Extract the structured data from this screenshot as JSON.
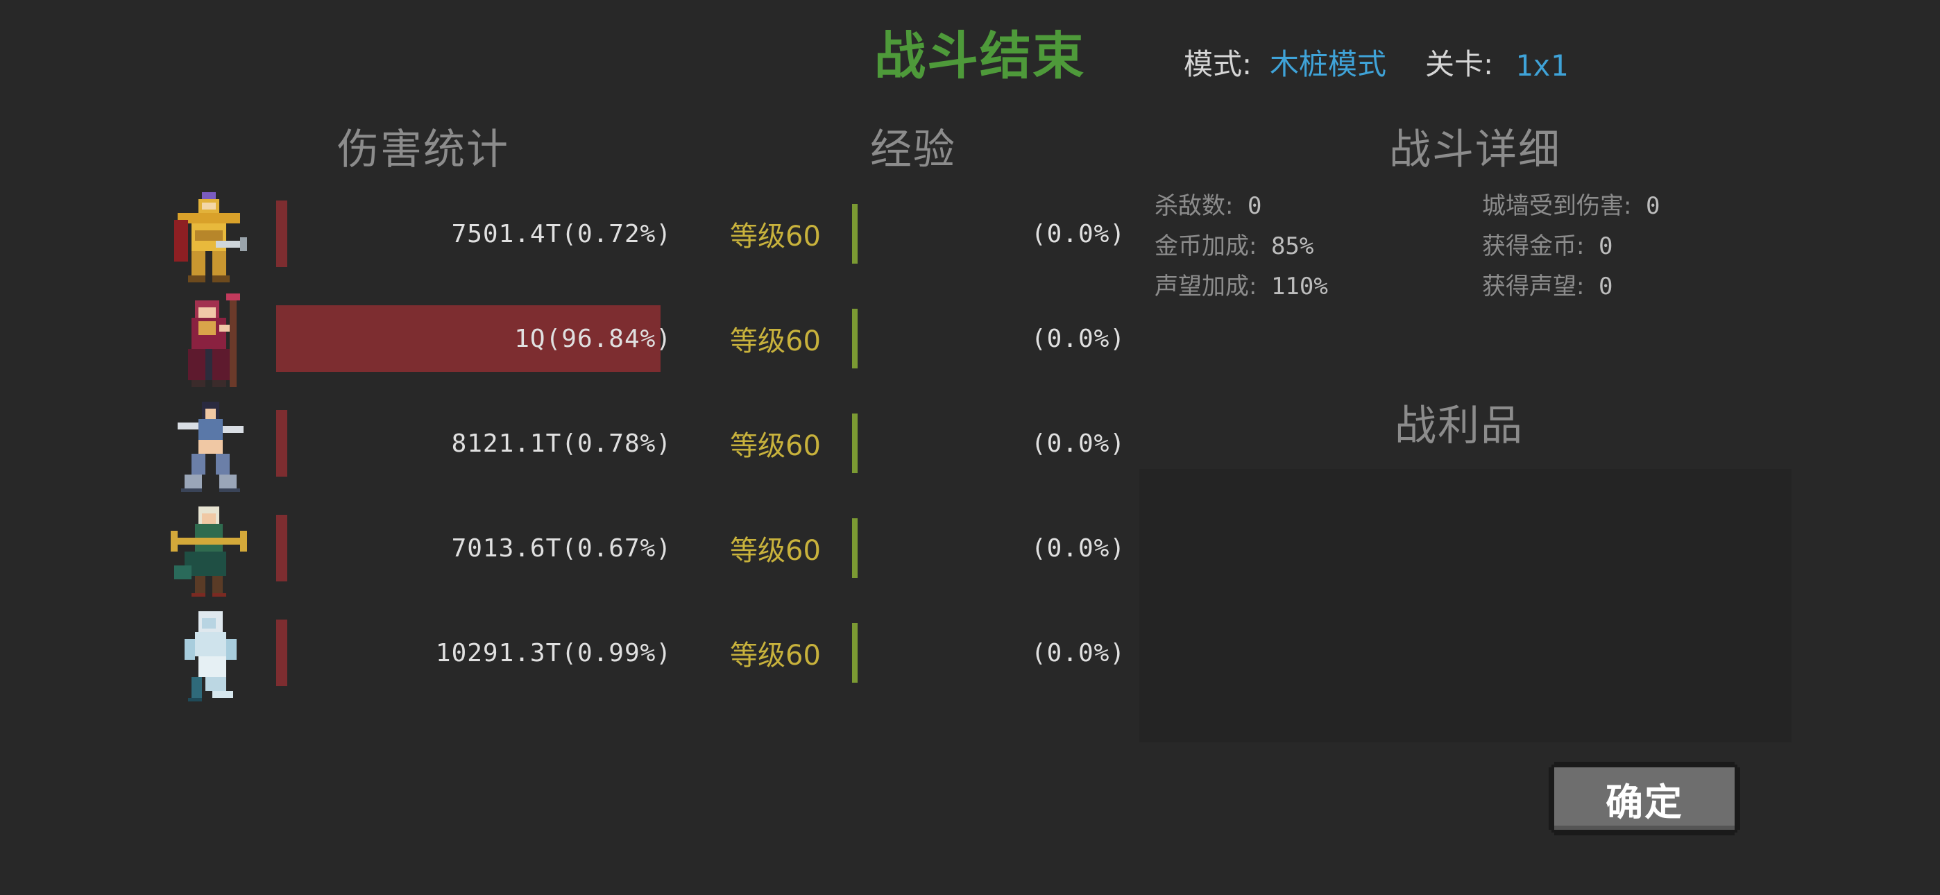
{
  "header": {
    "title": "战斗结束",
    "mode_label": "模式:",
    "mode_value": "木桩模式",
    "stage_label": "关卡:",
    "stage_value": "1x1"
  },
  "sections": {
    "damage": "伤害统计",
    "exp": "经验",
    "details": "战斗详细",
    "loot": "战利品"
  },
  "heroes": [
    {
      "icon": "golden-knight-icon",
      "damage": "7501.4T(0.72%)",
      "damage_share": 0.0072,
      "level": "等级60",
      "exp": "(0.0%)",
      "exp_share": 0.0
    },
    {
      "icon": "crimson-mage-icon",
      "damage": "1Q(96.84%)",
      "damage_share": 0.9684,
      "level": "等级60",
      "exp": "(0.0%)",
      "exp_share": 0.0
    },
    {
      "icon": "blade-dancer-icon",
      "damage": "8121.1T(0.78%)",
      "damage_share": 0.0078,
      "level": "等级60",
      "exp": "(0.0%)",
      "exp_share": 0.0
    },
    {
      "icon": "elf-archer-icon",
      "damage": "7013.6T(0.67%)",
      "damage_share": 0.0067,
      "level": "等级60",
      "exp": "(0.0%)",
      "exp_share": 0.0
    },
    {
      "icon": "ice-spirit-icon",
      "damage": "10291.3T(0.99%)",
      "damage_share": 0.0099,
      "level": "等级60",
      "exp": "(0.0%)",
      "exp_share": 0.0
    }
  ],
  "details": {
    "kills_label": "杀敌数:",
    "kills_value": "0",
    "gold_bonus_label": "金币加成:",
    "gold_bonus_value": "85%",
    "fame_bonus_label": "声望加成:",
    "fame_bonus_value": "110%",
    "wall_damage_label": "城墙受到伤害:",
    "wall_damage_value": "0",
    "gold_gained_label": "获得金币:",
    "gold_gained_value": "0",
    "fame_gained_label": "获得声望:",
    "fame_gained_value": "0"
  },
  "confirm_button": "确定",
  "colors": {
    "background": "#282828",
    "title": "#4e9a3a",
    "damage_bar": "#7d2d30",
    "level_text": "#c8b23c",
    "exp_bar": "#7b9a33",
    "mode_value": "#3fa3d8"
  }
}
